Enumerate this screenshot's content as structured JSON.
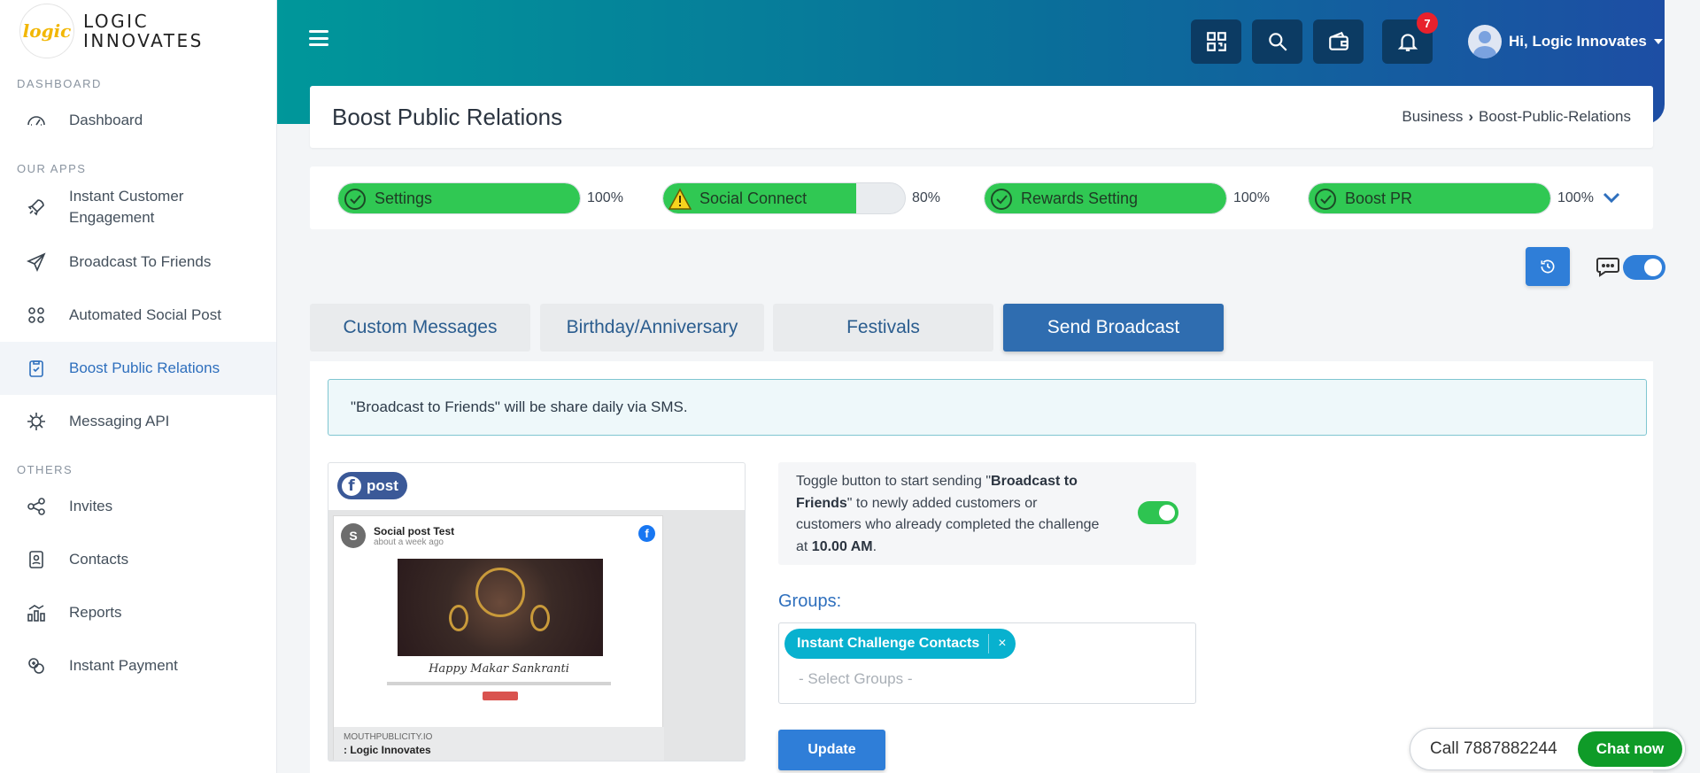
{
  "brand": {
    "logo_text": "logic",
    "name_line1": "LOGIC",
    "name_line2": "INNOVATES"
  },
  "sidebar": {
    "section_dashboard": "DASHBOARD",
    "section_apps": "OUR APPS",
    "section_others": "OTHERS",
    "items": [
      {
        "label": "Dashboard",
        "icon": "speedometer-icon"
      },
      {
        "label": "Instant Customer Engagement",
        "icon": "rocket-icon"
      },
      {
        "label": "Broadcast To Friends",
        "icon": "paper-plane-icon"
      },
      {
        "label": "Automated Social Post",
        "icon": "social-nodes-icon"
      },
      {
        "label": "Boost Public Relations",
        "icon": "clipboard-icon",
        "active": true
      },
      {
        "label": "Messaging API",
        "icon": "api-gear-icon"
      },
      {
        "label": "Invites",
        "icon": "share-icon"
      },
      {
        "label": "Contacts",
        "icon": "contact-book-icon"
      },
      {
        "label": "Reports",
        "icon": "bar-chart-icon"
      },
      {
        "label": "Instant Payment",
        "icon": "payment-icon"
      }
    ]
  },
  "header": {
    "menu_icon": "hamburger-icon",
    "buttons": [
      "qr-code-icon",
      "search-icon",
      "wallet-icon",
      "bell-icon"
    ],
    "notification_count": "7",
    "user_greeting": "Hi, Logic Innovates"
  },
  "page": {
    "title": "Boost Public Relations",
    "breadcrumb": [
      "Business",
      "Boost-Public-Relations"
    ]
  },
  "progress": [
    {
      "label": "Settings",
      "percent_text": "100%",
      "value": 100,
      "status": "check"
    },
    {
      "label": "Social Connect",
      "percent_text": "80%",
      "value": 80,
      "status": "warning"
    },
    {
      "label": "Rewards Setting",
      "percent_text": "100%",
      "value": 100,
      "status": "check"
    },
    {
      "label": "Boost PR",
      "percent_text": "100%",
      "value": 100,
      "status": "check"
    }
  ],
  "tabs": [
    {
      "label": "Custom Messages"
    },
    {
      "label": "Birthday/Anniversary"
    },
    {
      "label": "Festivals"
    },
    {
      "label": "Send Broadcast",
      "active": true
    }
  ],
  "info_message": "\"Broadcast to Friends\" will be share daily via SMS.",
  "post_preview": {
    "badge_label": "post",
    "avatar_letter": "S",
    "author": "Social post Test",
    "time": "about a week ago",
    "greeting": "Happy Makar Sankranti",
    "domain": "MOUTHPUBLICITY.IO",
    "footer_title": ": Logic Innovates"
  },
  "broadcast_toggle": {
    "text_1": "Toggle button to start sending \"",
    "bold_1": "Broadcast to Friends",
    "text_2": "\" to newly added customers or customers who already completed the challenge at ",
    "bold_2": "10.00 AM",
    "text_3": ".",
    "enabled": true
  },
  "groups": {
    "label": "Groups:",
    "selected": [
      "Instant Challenge Contacts"
    ],
    "remove_symbol": "×",
    "placeholder": "- Select Groups -"
  },
  "update_button": "Update",
  "call_widget": {
    "call_text": "Call 7887882244",
    "chat_button": "Chat now"
  },
  "colors": {
    "accent": "#2f7ed8",
    "progress_green": "#30c853",
    "chip": "#08b1cf",
    "chat_green": "#0f9b28"
  }
}
